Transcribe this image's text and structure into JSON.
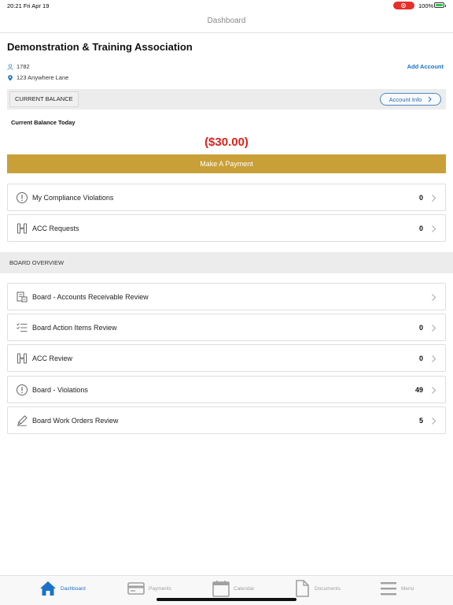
{
  "status_bar": {
    "time": "20:21  Fri Apr 19",
    "battery": "100%"
  },
  "nav": {
    "title": "Dashboard"
  },
  "account": {
    "name": "Demonstration & Training Association",
    "id": "1782",
    "address": "123 Anywhere Lane",
    "add_account_label": "Add Account"
  },
  "balance": {
    "section_label": "CURRENT BALANCE",
    "account_info_label": "Account Info",
    "today_label": "Current Balance Today",
    "amount": "($30.00)",
    "pay_button": "Make A Payment"
  },
  "top_items": [
    {
      "label": "My Compliance Violations",
      "count": "0",
      "icon": "alert-circle-icon"
    },
    {
      "label": "ACC Requests",
      "count": "0",
      "icon": "caliper-icon"
    }
  ],
  "board": {
    "section_title": "BOARD OVERVIEW",
    "items": [
      {
        "label": "Board - Accounts Receivable Review",
        "count": "",
        "icon": "ledger-icon"
      },
      {
        "label": "Board Action Items Review",
        "count": "0",
        "icon": "checklist-icon"
      },
      {
        "label": "ACC Review",
        "count": "0",
        "icon": "caliper-icon"
      },
      {
        "label": "Board - Violations",
        "count": "49",
        "icon": "alert-circle-icon"
      },
      {
        "label": "Board Work Orders Review",
        "count": "5",
        "icon": "pen-icon"
      }
    ]
  },
  "tabs": [
    {
      "label": "Dashboard",
      "icon": "home-icon",
      "active": true
    },
    {
      "label": "Payments",
      "icon": "card-icon",
      "active": false
    },
    {
      "label": "Calendar",
      "icon": "calendar-icon",
      "active": false
    },
    {
      "label": "Documents",
      "icon": "document-icon",
      "active": false
    },
    {
      "label": "Menu",
      "icon": "menu-icon",
      "active": false
    }
  ],
  "colors": {
    "accent": "#1a73c8",
    "pay_button": "#c99f37",
    "balance_negative": "#d8231d",
    "section_band": "#ececec"
  }
}
